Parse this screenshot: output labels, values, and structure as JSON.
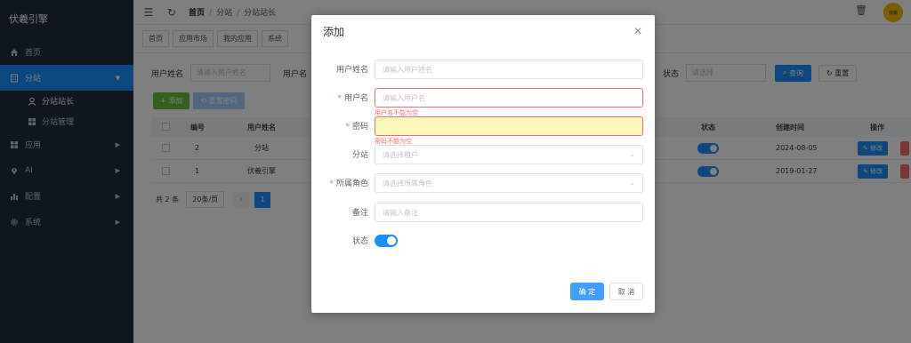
{
  "brand": "伏羲引擎",
  "menu": [
    {
      "label": "首页",
      "icon": "home-icon",
      "has_arrow": false
    },
    {
      "label": "分站",
      "icon": "building-icon",
      "has_arrow": true,
      "active": true
    },
    {
      "label": "应用",
      "icon": "grid-icon",
      "has_arrow": true
    },
    {
      "label": "AI",
      "icon": "location-pin-icon",
      "has_arrow": true
    },
    {
      "label": "配置",
      "icon": "bar-chart-icon",
      "has_arrow": true
    },
    {
      "label": "系统",
      "icon": "gear-icon",
      "has_arrow": true
    }
  ],
  "submenu": [
    {
      "label": "分站站长",
      "icon": "user-icon"
    },
    {
      "label": "分站管理",
      "icon": "grid-icon"
    }
  ],
  "header": {
    "breadcrumb": [
      "首页",
      "分站",
      "分站站长"
    ],
    "avatar_text": "伏羲"
  },
  "tags": [
    "首页",
    "应用市场",
    "我的应用",
    "系统"
  ],
  "search": {
    "nickname_label": "用户姓名",
    "nickname_placeholder": "请输入用户姓名",
    "username_label": "用户名",
    "status_label": "状态",
    "status_placeholder": "请选择",
    "query_button": "查询",
    "reset_button": "重置"
  },
  "toolbar": {
    "add_button": "添加",
    "reset_pwd_button": "重置密码"
  },
  "table": {
    "columns": [
      "编号",
      "用户姓名",
      "状态",
      "创建时间",
      "操作"
    ],
    "rows": [
      {
        "id": "2",
        "name": "分站",
        "created": "2024-08-05"
      },
      {
        "id": "1",
        "name": "伏羲引擎",
        "created": "2019-01-27"
      }
    ],
    "edit_label": "修改"
  },
  "pager": {
    "total": "共 2 条",
    "page_size": "20条/页",
    "current_page": "1"
  },
  "dialog": {
    "title": "添加",
    "fields": {
      "nickname": {
        "label": "用户姓名",
        "placeholder": "请输入用户姓名"
      },
      "username": {
        "label": "用户名",
        "placeholder": "请输入用户名",
        "error": "用户名不能为空"
      },
      "password": {
        "label": "密码",
        "placeholder": "",
        "error": "密码不能为空"
      },
      "tenant": {
        "label": "分站",
        "placeholder": "请选择租户"
      },
      "role": {
        "label": "所属角色",
        "placeholder": "请选择所属角色"
      },
      "remark": {
        "label": "备注",
        "placeholder": "请输入备注"
      },
      "status": {
        "label": "状态"
      }
    },
    "ok_button": "确 定",
    "cancel_button": "取 消"
  }
}
